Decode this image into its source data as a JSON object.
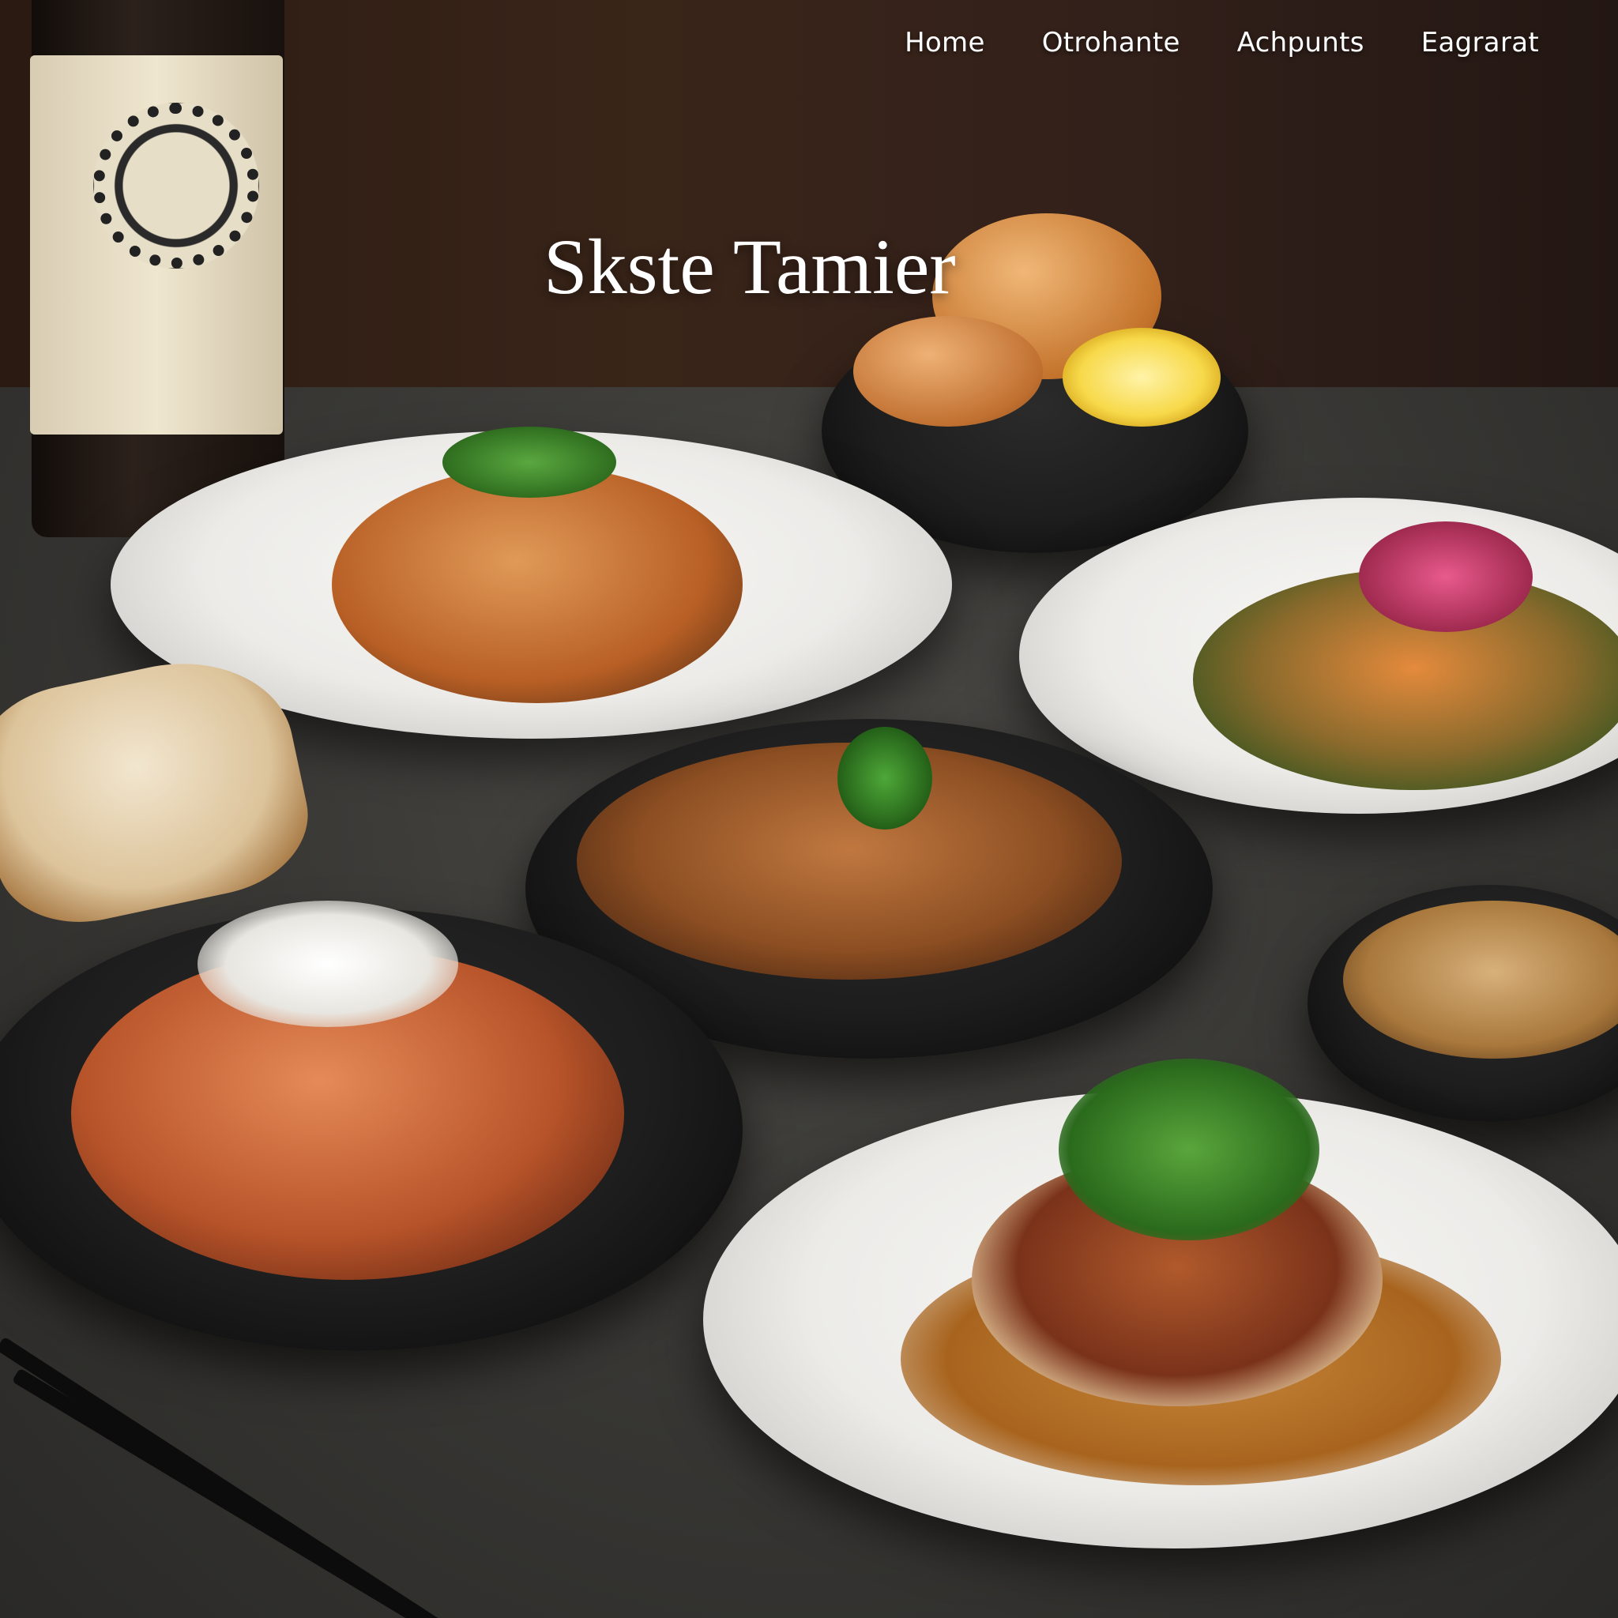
{
  "nav": {
    "items": [
      {
        "label": "Home"
      },
      {
        "label": "Otrohante"
      },
      {
        "label": "Achpunts"
      },
      {
        "label": "Eagrarat"
      }
    ]
  },
  "hero": {
    "title": "Skste Tamier"
  },
  "icons": {
    "bottle": "bottle-icon"
  }
}
